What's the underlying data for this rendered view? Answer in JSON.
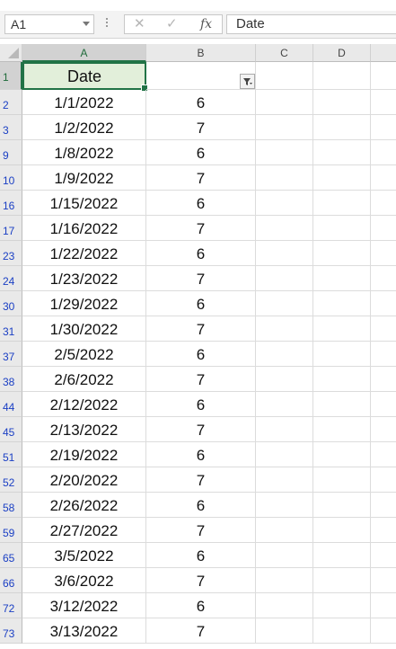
{
  "formula_bar": {
    "name_box": "A1",
    "cancel_glyph": "✕",
    "enter_glyph": "✓",
    "fx_label": "fx",
    "formula_value": "Date"
  },
  "columns": [
    "A",
    "B",
    "C",
    "D"
  ],
  "header": {
    "a1": "Date",
    "row_number": "1",
    "filter_icon": "filter-active-icon"
  },
  "rows": [
    {
      "num": "2",
      "date": "1/1/2022",
      "b": "6"
    },
    {
      "num": "3",
      "date": "1/2/2022",
      "b": "7"
    },
    {
      "num": "9",
      "date": "1/8/2022",
      "b": "6"
    },
    {
      "num": "10",
      "date": "1/9/2022",
      "b": "7"
    },
    {
      "num": "16",
      "date": "1/15/2022",
      "b": "6"
    },
    {
      "num": "17",
      "date": "1/16/2022",
      "b": "7"
    },
    {
      "num": "23",
      "date": "1/22/2022",
      "b": "6"
    },
    {
      "num": "24",
      "date": "1/23/2022",
      "b": "7"
    },
    {
      "num": "30",
      "date": "1/29/2022",
      "b": "6"
    },
    {
      "num": "31",
      "date": "1/30/2022",
      "b": "7"
    },
    {
      "num": "37",
      "date": "2/5/2022",
      "b": "6"
    },
    {
      "num": "38",
      "date": "2/6/2022",
      "b": "7"
    },
    {
      "num": "44",
      "date": "2/12/2022",
      "b": "6"
    },
    {
      "num": "45",
      "date": "2/13/2022",
      "b": "7"
    },
    {
      "num": "51",
      "date": "2/19/2022",
      "b": "6"
    },
    {
      "num": "52",
      "date": "2/20/2022",
      "b": "7"
    },
    {
      "num": "58",
      "date": "2/26/2022",
      "b": "6"
    },
    {
      "num": "59",
      "date": "2/27/2022",
      "b": "7"
    },
    {
      "num": "65",
      "date": "3/5/2022",
      "b": "6"
    },
    {
      "num": "66",
      "date": "3/6/2022",
      "b": "7"
    },
    {
      "num": "72",
      "date": "3/12/2022",
      "b": "6"
    },
    {
      "num": "73",
      "date": "3/13/2022",
      "b": "7"
    }
  ],
  "colors": {
    "accent": "#217346",
    "selected_cell_fill": "#e2efda",
    "row_number_text": "#1a3fc4"
  }
}
